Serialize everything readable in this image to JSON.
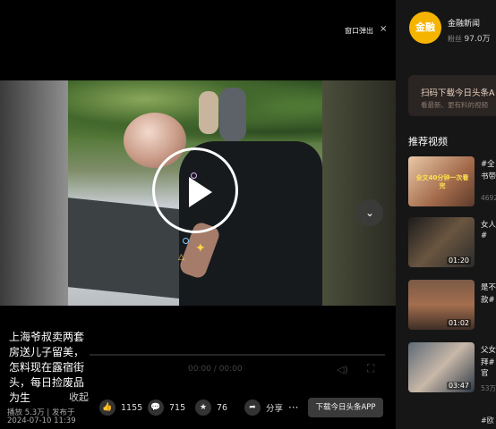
{
  "player": {
    "popout_label": "窗口弹出",
    "close_label": "×",
    "ghost_time": "00:00 / 00:00",
    "caption": "上海爷叔卖两套房送儿子留美，怎料现在露宿街头，每日捡废品为生",
    "collapse_label": "收起",
    "views_line": "播放 5.3万 | 发布于",
    "date_line": "2024-07-10 11:39"
  },
  "actions": {
    "like_count": "1155",
    "comment_count": "715",
    "favorite_count": "76",
    "share_label": "分享",
    "more_label": "···",
    "download_label": "下载今日头条APP"
  },
  "sidebar": {
    "author_avatar_text": "金融",
    "author_name": "金融新闻",
    "fans_label": "粉丝",
    "fans_count": "97.0万",
    "promo_title": "扫码下载今日头条A",
    "promo_sub": "看最新、更有料的视频",
    "rec_title": "推荐视频",
    "rec_items": [
      {
        "thumb_caption": "全文40分钟一次看完",
        "line1": "#全",
        "line2": "书带",
        "duration": "",
        "meta": "4692"
      },
      {
        "thumb_caption": "",
        "line1": "女人",
        "line2": "#",
        "duration": "01:20",
        "meta": ""
      },
      {
        "thumb_caption": "",
        "line1": "是不",
        "line2": "款#",
        "duration": "01:02",
        "meta": ""
      },
      {
        "thumb_caption": "",
        "line1": "父女",
        "line2": "拜#",
        "duration": "03:47",
        "meta": "53万"
      }
    ],
    "rec_extra_line": "官",
    "bottom_line": "#欧"
  },
  "colors": {
    "avatar_bg": "#f5b400",
    "sidebar_bg": "#161616",
    "player_bg": "#000000"
  }
}
